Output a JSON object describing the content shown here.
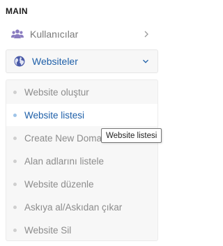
{
  "section_title": "MAIN",
  "menu": {
    "users": {
      "label": "Kullanıcılar",
      "icon": "users-icon"
    },
    "websites": {
      "label": "Websiteler",
      "icon": "globe-icon"
    }
  },
  "submenu_items": [
    {
      "label": "Website oluştur",
      "active": false
    },
    {
      "label": "Website listesi",
      "active": true
    },
    {
      "label": "Create New Domain",
      "active": false
    },
    {
      "label": "Alan adlarını listele",
      "active": false
    },
    {
      "label": "Website düzenle",
      "active": false
    },
    {
      "label": "Askıya al/Askıdan çıkar",
      "active": false
    },
    {
      "label": "Website Sil",
      "active": false
    }
  ],
  "tooltip": {
    "text": "Website listesi"
  },
  "colors": {
    "accent": "#1e5fa8",
    "icon_users": "#8a7cc0",
    "icon_globe": "#4a5aa8",
    "muted_text": "#8c8c8c"
  }
}
